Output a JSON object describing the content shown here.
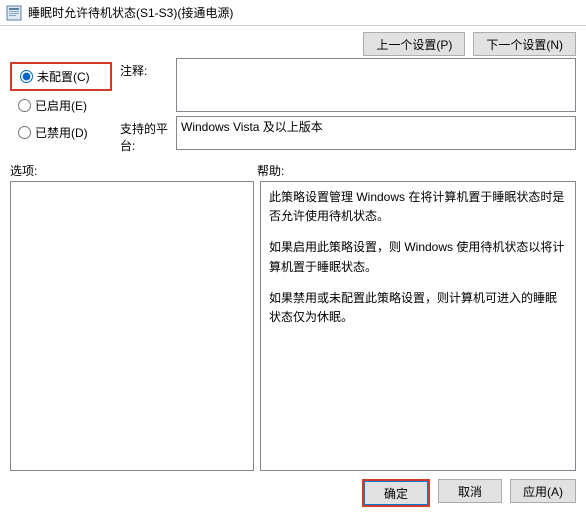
{
  "window": {
    "title": "睡眠时允许待机状态(S1-S3)(接通电源)"
  },
  "nav": {
    "prev": "上一个设置(P)",
    "next": "下一个设置(N)"
  },
  "radios": {
    "not_configured": "未配置(C)",
    "enabled": "已启用(E)",
    "disabled": "已禁用(D)"
  },
  "fields": {
    "comment_label": "注释:",
    "comment_value": "",
    "platform_label": "支持的平台:",
    "platform_value": "Windows Vista 及以上版本"
  },
  "sections": {
    "options_label": "选项:",
    "help_label": "帮助:"
  },
  "help": {
    "p1": "此策略设置管理 Windows 在将计算机置于睡眠状态时是否允许使用待机状态。",
    "p2": "如果启用此策略设置，则 Windows 使用待机状态以将计算机置于睡眠状态。",
    "p3": "如果禁用或未配置此策略设置，则计算机可进入的睡眠状态仅为休眠。"
  },
  "buttons": {
    "ok": "确定",
    "cancel": "取消",
    "apply": "应用(A)"
  }
}
